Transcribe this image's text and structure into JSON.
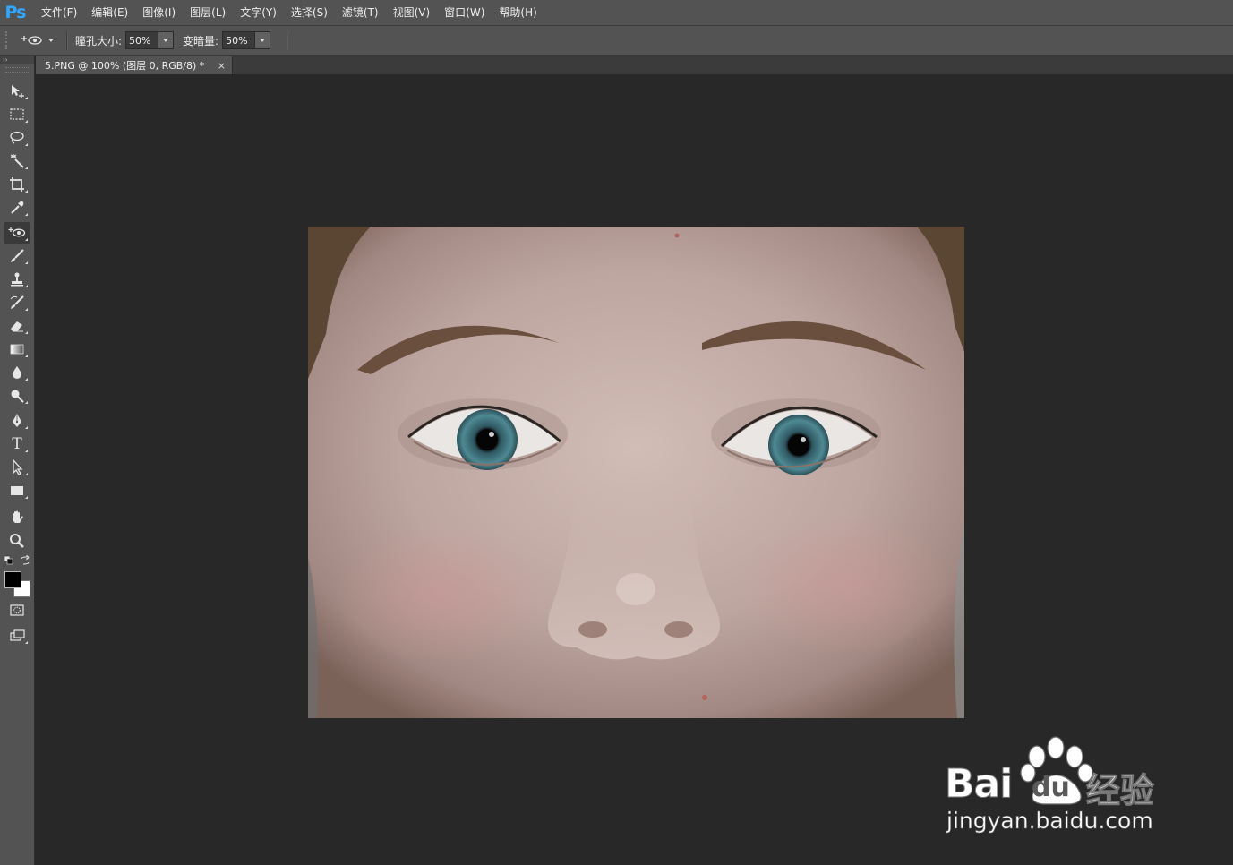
{
  "app": {
    "logo": "Ps",
    "menu": [
      "文件(F)",
      "编辑(E)",
      "图像(I)",
      "图层(L)",
      "文字(Y)",
      "选择(S)",
      "滤镜(T)",
      "视图(V)",
      "窗口(W)",
      "帮助(H)"
    ]
  },
  "options": {
    "pupil_size_label": "瞳孔大小:",
    "pupil_size_value": "50%",
    "darken_label": "变暗量:",
    "darken_value": "50%"
  },
  "document": {
    "tab_title": "5.PNG @ 100% (图层 0, RGB/8) *",
    "close_glyph": "×"
  },
  "toolbar": {
    "expand_glyph": "››",
    "tools": [
      "move-tool",
      "marquee-tool",
      "lasso-tool",
      "magic-wand-tool",
      "crop-tool",
      "eyedropper-tool",
      "red-eye-tool",
      "brush-tool",
      "clone-stamp-tool",
      "history-brush-tool",
      "eraser-tool",
      "gradient-tool",
      "blur-tool",
      "dodge-tool",
      "pen-tool",
      "type-tool",
      "path-selection-tool",
      "rectangle-tool",
      "hand-tool",
      "zoom-tool"
    ],
    "active_tool": "red-eye-tool",
    "type_tool_glyph": "T",
    "foreground_color": "#000000",
    "background_color": "#ffffff"
  },
  "watermark": {
    "brand_left": "Bai",
    "brand_mid": "du",
    "brand_right": "经验",
    "url": "jingyan.baidu.com"
  }
}
